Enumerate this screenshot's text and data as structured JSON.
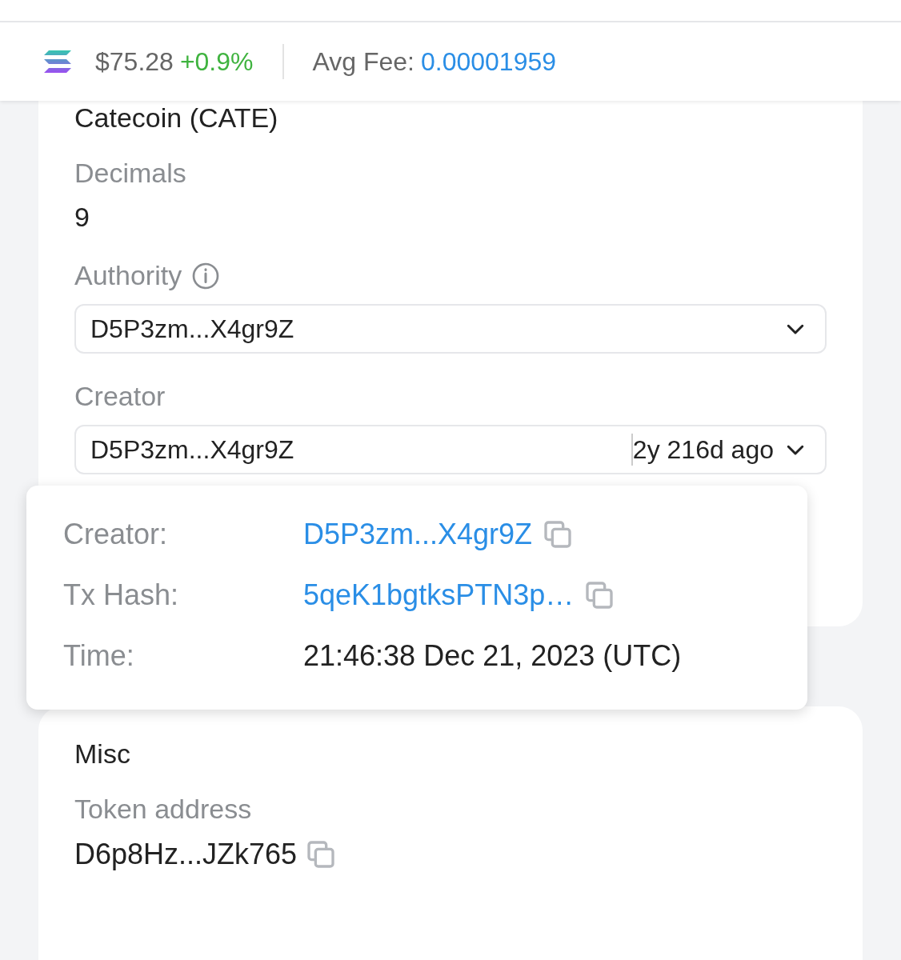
{
  "header": {
    "price": "$75.28",
    "change": "+0.9%",
    "fee_label": "Avg Fee:",
    "fee_value": "0.00001959"
  },
  "overview": {
    "name": "Catecoin (CATE)",
    "fields": [
      {
        "kind": "text",
        "label": "Decimals",
        "value": "9"
      },
      {
        "kind": "select",
        "label": "Authority",
        "info": true,
        "value": "D5P3zm...X4gr9Z"
      },
      {
        "kind": "select",
        "label": "Creator",
        "info": false,
        "value": "D5P3zm...X4gr9Z",
        "meta": "2y 216d ago"
      }
    ]
  },
  "popover": {
    "rows": [
      {
        "kind": "link",
        "label": "Creator:",
        "value": "D5P3zm...X4gr9Z",
        "copy": true
      },
      {
        "kind": "link",
        "label": "Tx Hash:",
        "value": "5qeK1bgtksPTN3p…",
        "copy": true
      },
      {
        "kind": "text",
        "label": "Time:",
        "value": "21:46:38 Dec 21, 2023 (UTC)",
        "copy": false
      }
    ]
  },
  "misc": {
    "title": "Misc",
    "fields": [
      {
        "label": "Token address",
        "value": "D6p8Hz...JZk765",
        "copy": true
      }
    ]
  }
}
